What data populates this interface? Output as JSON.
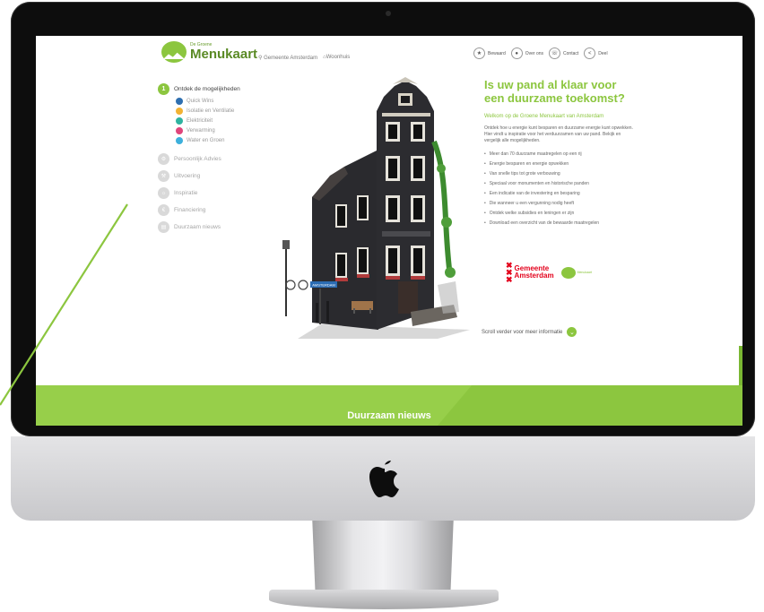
{
  "header": {
    "logo_small": "De Groene",
    "logo_big": "Menukaart",
    "location": "Gemeente Amsterdam",
    "building_type": "Woonhuis",
    "nav": [
      {
        "label": "Bewaard",
        "icon": "star-icon"
      },
      {
        "label": "Over ons",
        "icon": "people-icon"
      },
      {
        "label": "Contact",
        "icon": "phone-icon"
      },
      {
        "label": "Deel",
        "icon": "share-icon"
      }
    ]
  },
  "sidebar": {
    "main_number": "1",
    "main_label": "Ontdek de mogelijkheden",
    "subitems": [
      {
        "label": "Quick Wins",
        "color": "#2e6fb0"
      },
      {
        "label": "Isolatie en Ventilatie",
        "color": "#f2b233"
      },
      {
        "label": "Elektriciteit",
        "color": "#2fb3a0"
      },
      {
        "label": "Verwarming",
        "color": "#e0457b"
      },
      {
        "label": "Water en Groen",
        "color": "#3db0dc"
      }
    ],
    "items": [
      {
        "label": "Persoonlijk Advies"
      },
      {
        "label": "Uitvoering"
      },
      {
        "label": "Inspiratie"
      },
      {
        "label": "Financiering"
      },
      {
        "label": "Duurzaam nieuws"
      }
    ]
  },
  "content": {
    "headline": "Is uw pand al klaar voor een duurzame toekomst?",
    "welkom": "Welkom op de Groene Menukaart van Amsterdam",
    "intro": "Ontdek hoe u energie kunt besparen en duurzame energie kunt opwekken. Hier vindt u inspiratie voor het verduurzamen van uw pand. Bekijk en vergelijk alle mogelijkheden.",
    "bullets": [
      "Meer dan 70 duurzame maatregelen op een rij",
      "Energie besparen en energie opwekken",
      "Van snelle tips tot grote verbouwing",
      "Speciaal voor monumenten en historische panden",
      "Een indicatie van de investering en besparing",
      "Die wanneer u een vergunning nodig heeft",
      "Ontdek welke subsidies en leningen er zijn",
      "Download een overzicht van de bewaarde maatregelen"
    ],
    "gemeente_line1": "Gemeente",
    "gemeente_line2": "Amsterdam",
    "street_sign": "AMSTERDAM",
    "scroll_text": "Scroll verder voor meer informatie"
  },
  "band": {
    "title": "Duurzaam nieuws"
  },
  "colors": {
    "brand_green": "#8cc63f"
  }
}
